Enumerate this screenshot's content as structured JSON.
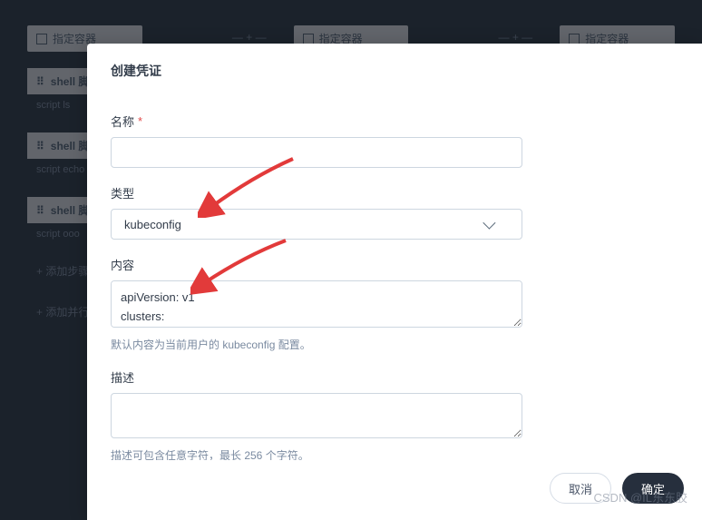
{
  "background": {
    "headerLabel": "指定容器",
    "sepLabel": "— + —",
    "shellLabel": "shell 脚",
    "scriptLs": "script   ls",
    "scriptEcho": "script   echo",
    "scriptOoo": "script   ooo",
    "addStep": "+  添加步骤",
    "addRun": "+  添加并行"
  },
  "modal": {
    "title": "创建凭证",
    "name": {
      "label": "名称",
      "value": ""
    },
    "type": {
      "label": "类型",
      "selected": "kubeconfig"
    },
    "content": {
      "label": "内容",
      "value": "apiVersion: v1\nclusters:",
      "help": "默认内容为当前用户的 kubeconfig 配置。"
    },
    "description": {
      "label": "描述",
      "value": "",
      "help": "描述可包含任意字符，最长 256 个字符。"
    },
    "footer": {
      "cancel": "取消",
      "confirm": "确定"
    }
  },
  "watermark": "CSDN @IL东东胶"
}
